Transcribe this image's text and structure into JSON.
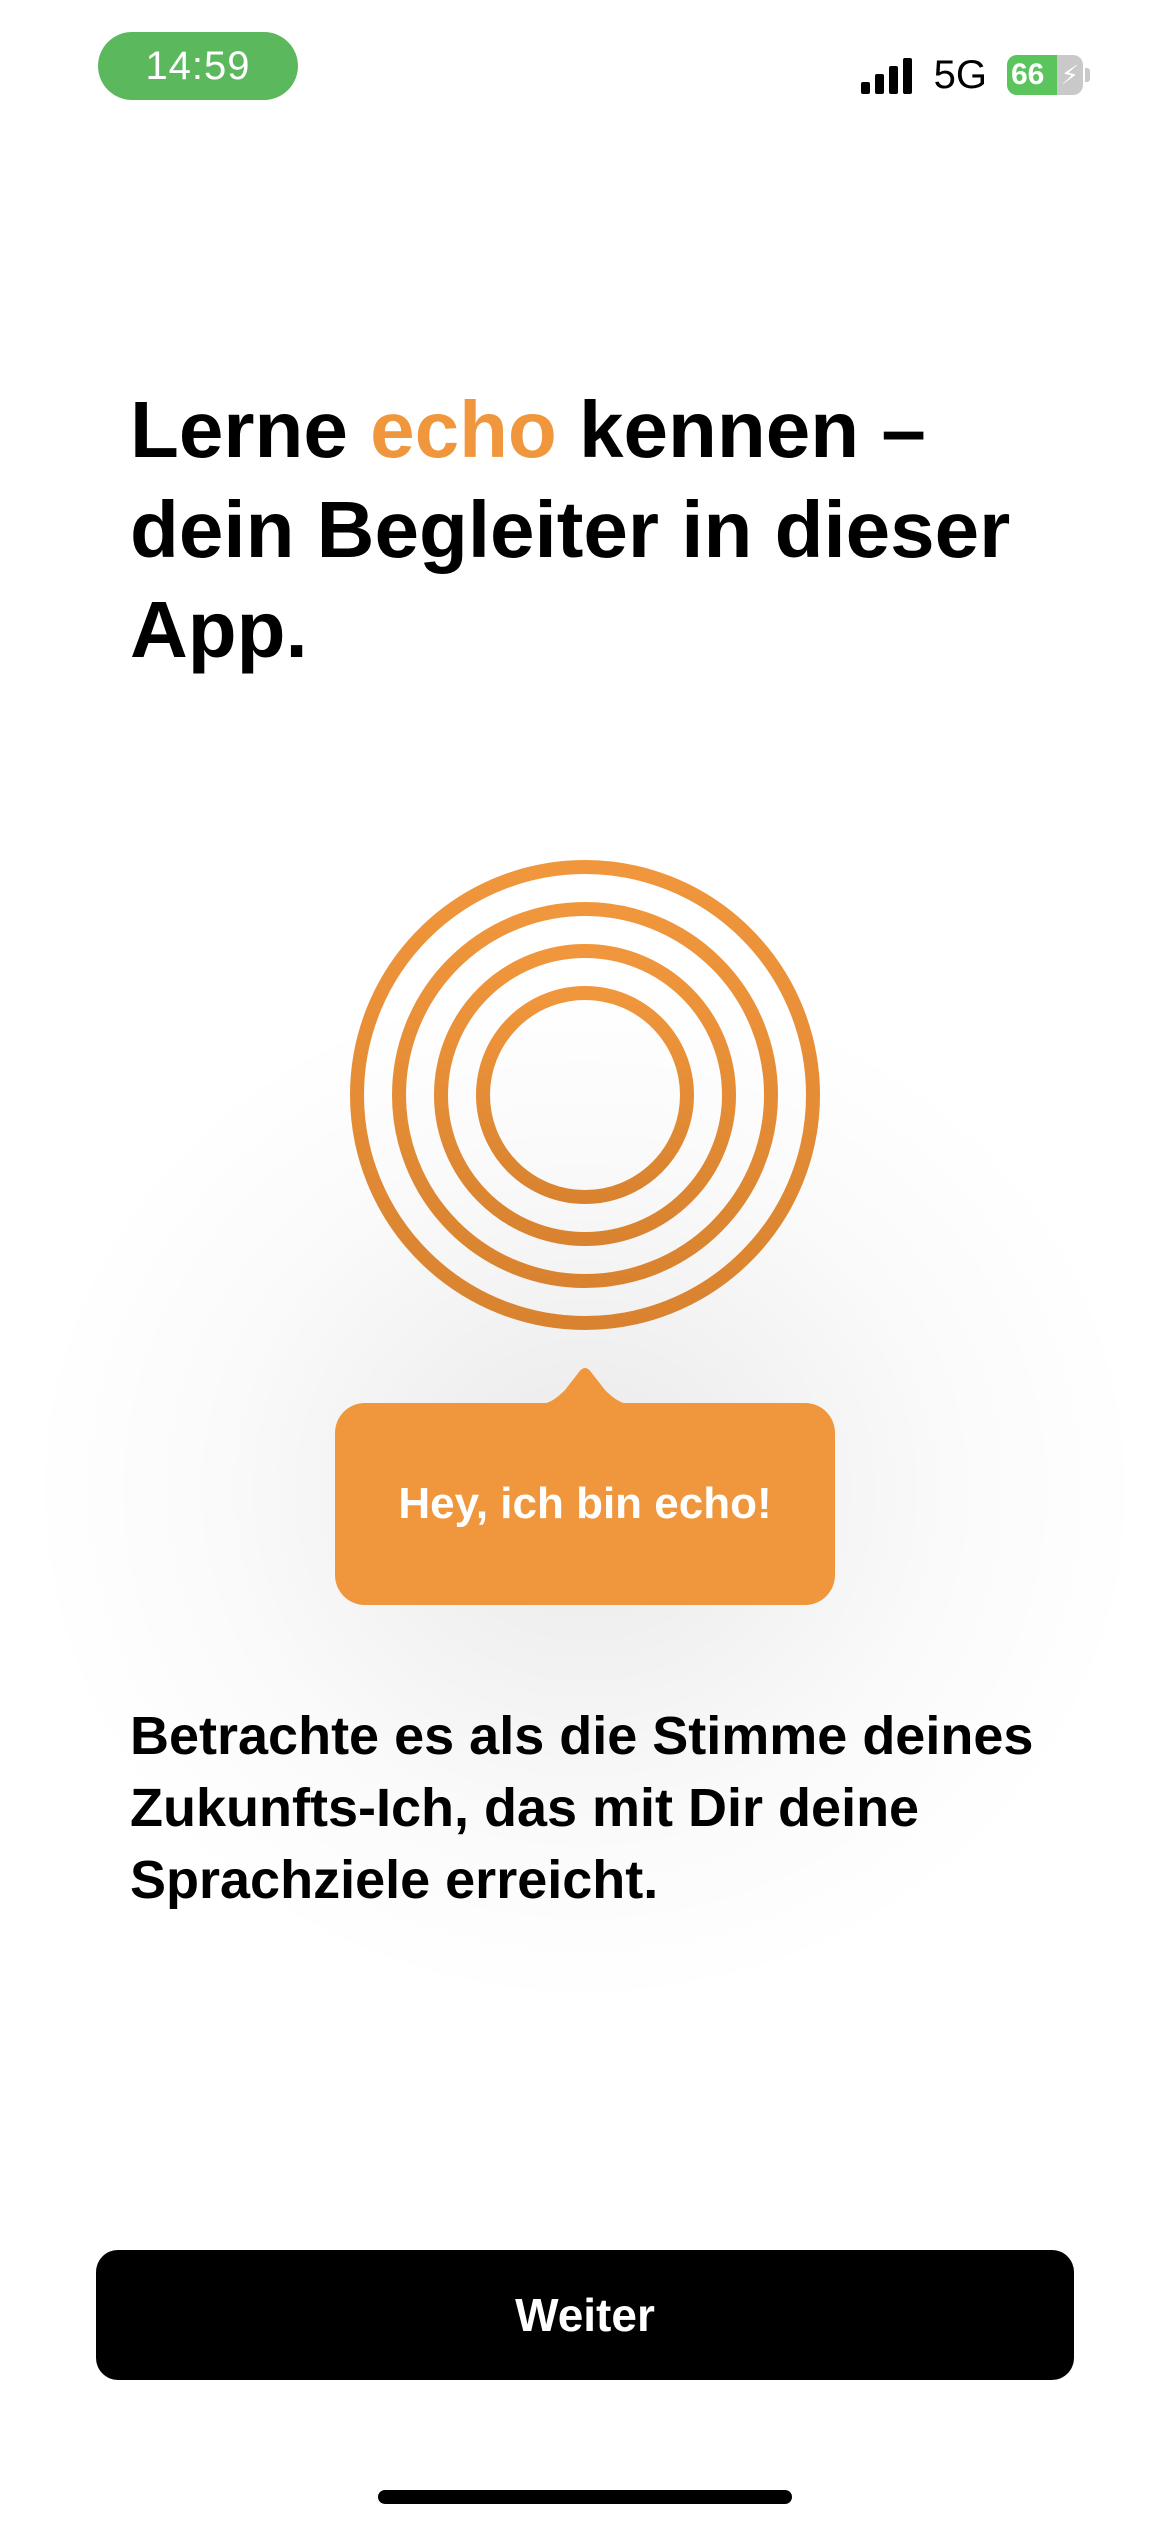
{
  "status_bar": {
    "time": "14:59",
    "network": "5G",
    "battery_level": "66",
    "battery_fraction": 0.66,
    "battery_charging": true,
    "signal_bars": 4
  },
  "headline": {
    "part1": "Lerne ",
    "accent": "echo",
    "part2": " kennen – dein Begleiter in dieser App."
  },
  "speech_bubble": {
    "text": "Hey, ich bin echo!"
  },
  "description": "Betrachte es als die Stimme deines Zukunfts-Ich, das mit Dir deine Sprachziele erreicht.",
  "continue_button": {
    "label": "Weiter"
  },
  "colors": {
    "accent": "#f0963c",
    "status_pill": "#5cb85c",
    "button_bg": "#000000",
    "button_text": "#ffffff"
  },
  "icons": {
    "logo": "echo-rings-icon",
    "signal": "cellular-signal-icon",
    "battery": "battery-charging-icon"
  }
}
